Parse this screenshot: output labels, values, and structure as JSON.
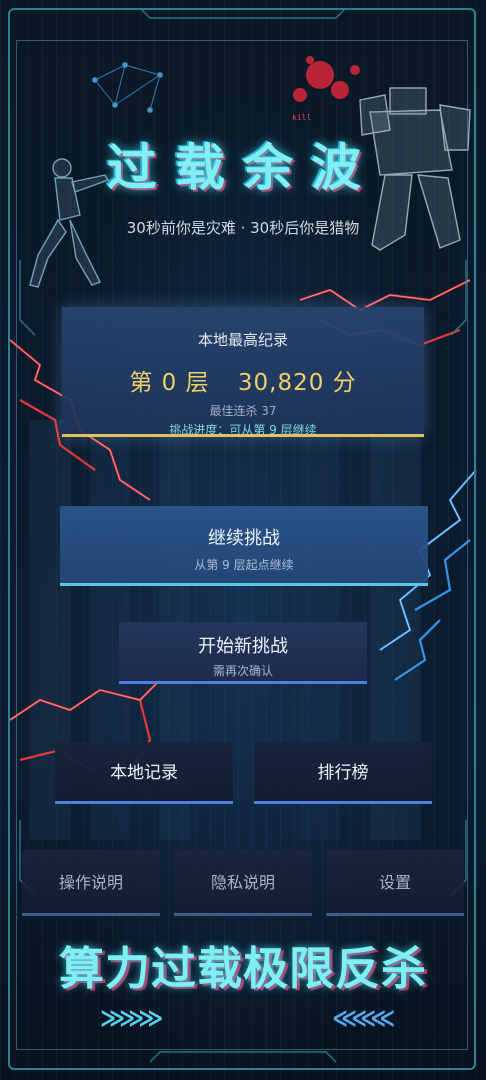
{
  "title": "过载余波",
  "subtitle": "30秒前你是灾难 · 30秒后你是猎物",
  "record": {
    "label": "本地最高纪录",
    "floor": "第 0 层",
    "score": "30,820 分",
    "streak": "最佳连杀 37",
    "progress": "挑战进度：可从第 9 层继续"
  },
  "buttons": {
    "continue": {
      "label": "继续挑战",
      "sub": "从第 9 层起点继续"
    },
    "new_challenge": {
      "label": "开始新挑战",
      "sub": "需再次确认"
    },
    "local_records": "本地记录",
    "leaderboard": "排行榜",
    "instructions": "操作说明",
    "privacy": "隐私说明",
    "settings": "设置"
  },
  "slogan": "算力过载极限反杀",
  "decor": {
    "arrows_left": "≫≫≫",
    "arrows_right": "≪≪≪",
    "bg_text": "kill"
  },
  "colors": {
    "title": "#7ef0f4",
    "gold": "#f0cf6a",
    "cyan_accent": "#5ac6e4",
    "blue_accent": "#4f7fe0",
    "lightning_red": "#ff3b3b",
    "lightning_blue": "#3aa0ff"
  }
}
